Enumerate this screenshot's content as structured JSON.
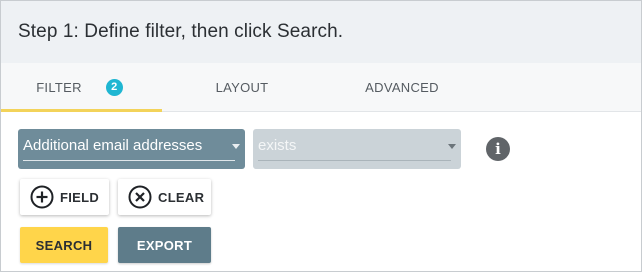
{
  "header": {
    "title": "Step 1: Define filter, then click Search."
  },
  "tabs": {
    "filter": {
      "label": "FILTER",
      "badge": "2"
    },
    "layout": {
      "label": "LAYOUT"
    },
    "advanced": {
      "label": "ADVANCED"
    }
  },
  "filter_row": {
    "field_select": {
      "value": "Additional email addresses"
    },
    "operator_select": {
      "value": "exists"
    },
    "info_icon": "info-icon"
  },
  "buttons": {
    "field": "FIELD",
    "clear": "CLEAR",
    "search": "SEARCH",
    "export": "EXPORT"
  },
  "colors": {
    "header_bg": "#eef1f4",
    "tab_active_underline": "#f3d35a",
    "badge": "#1fb6d2",
    "field_select_bg": "#6f8c9a",
    "operator_select_bg": "#cbd3d8",
    "search_button": "#ffd54a",
    "export_button": "#5e7c8a"
  }
}
